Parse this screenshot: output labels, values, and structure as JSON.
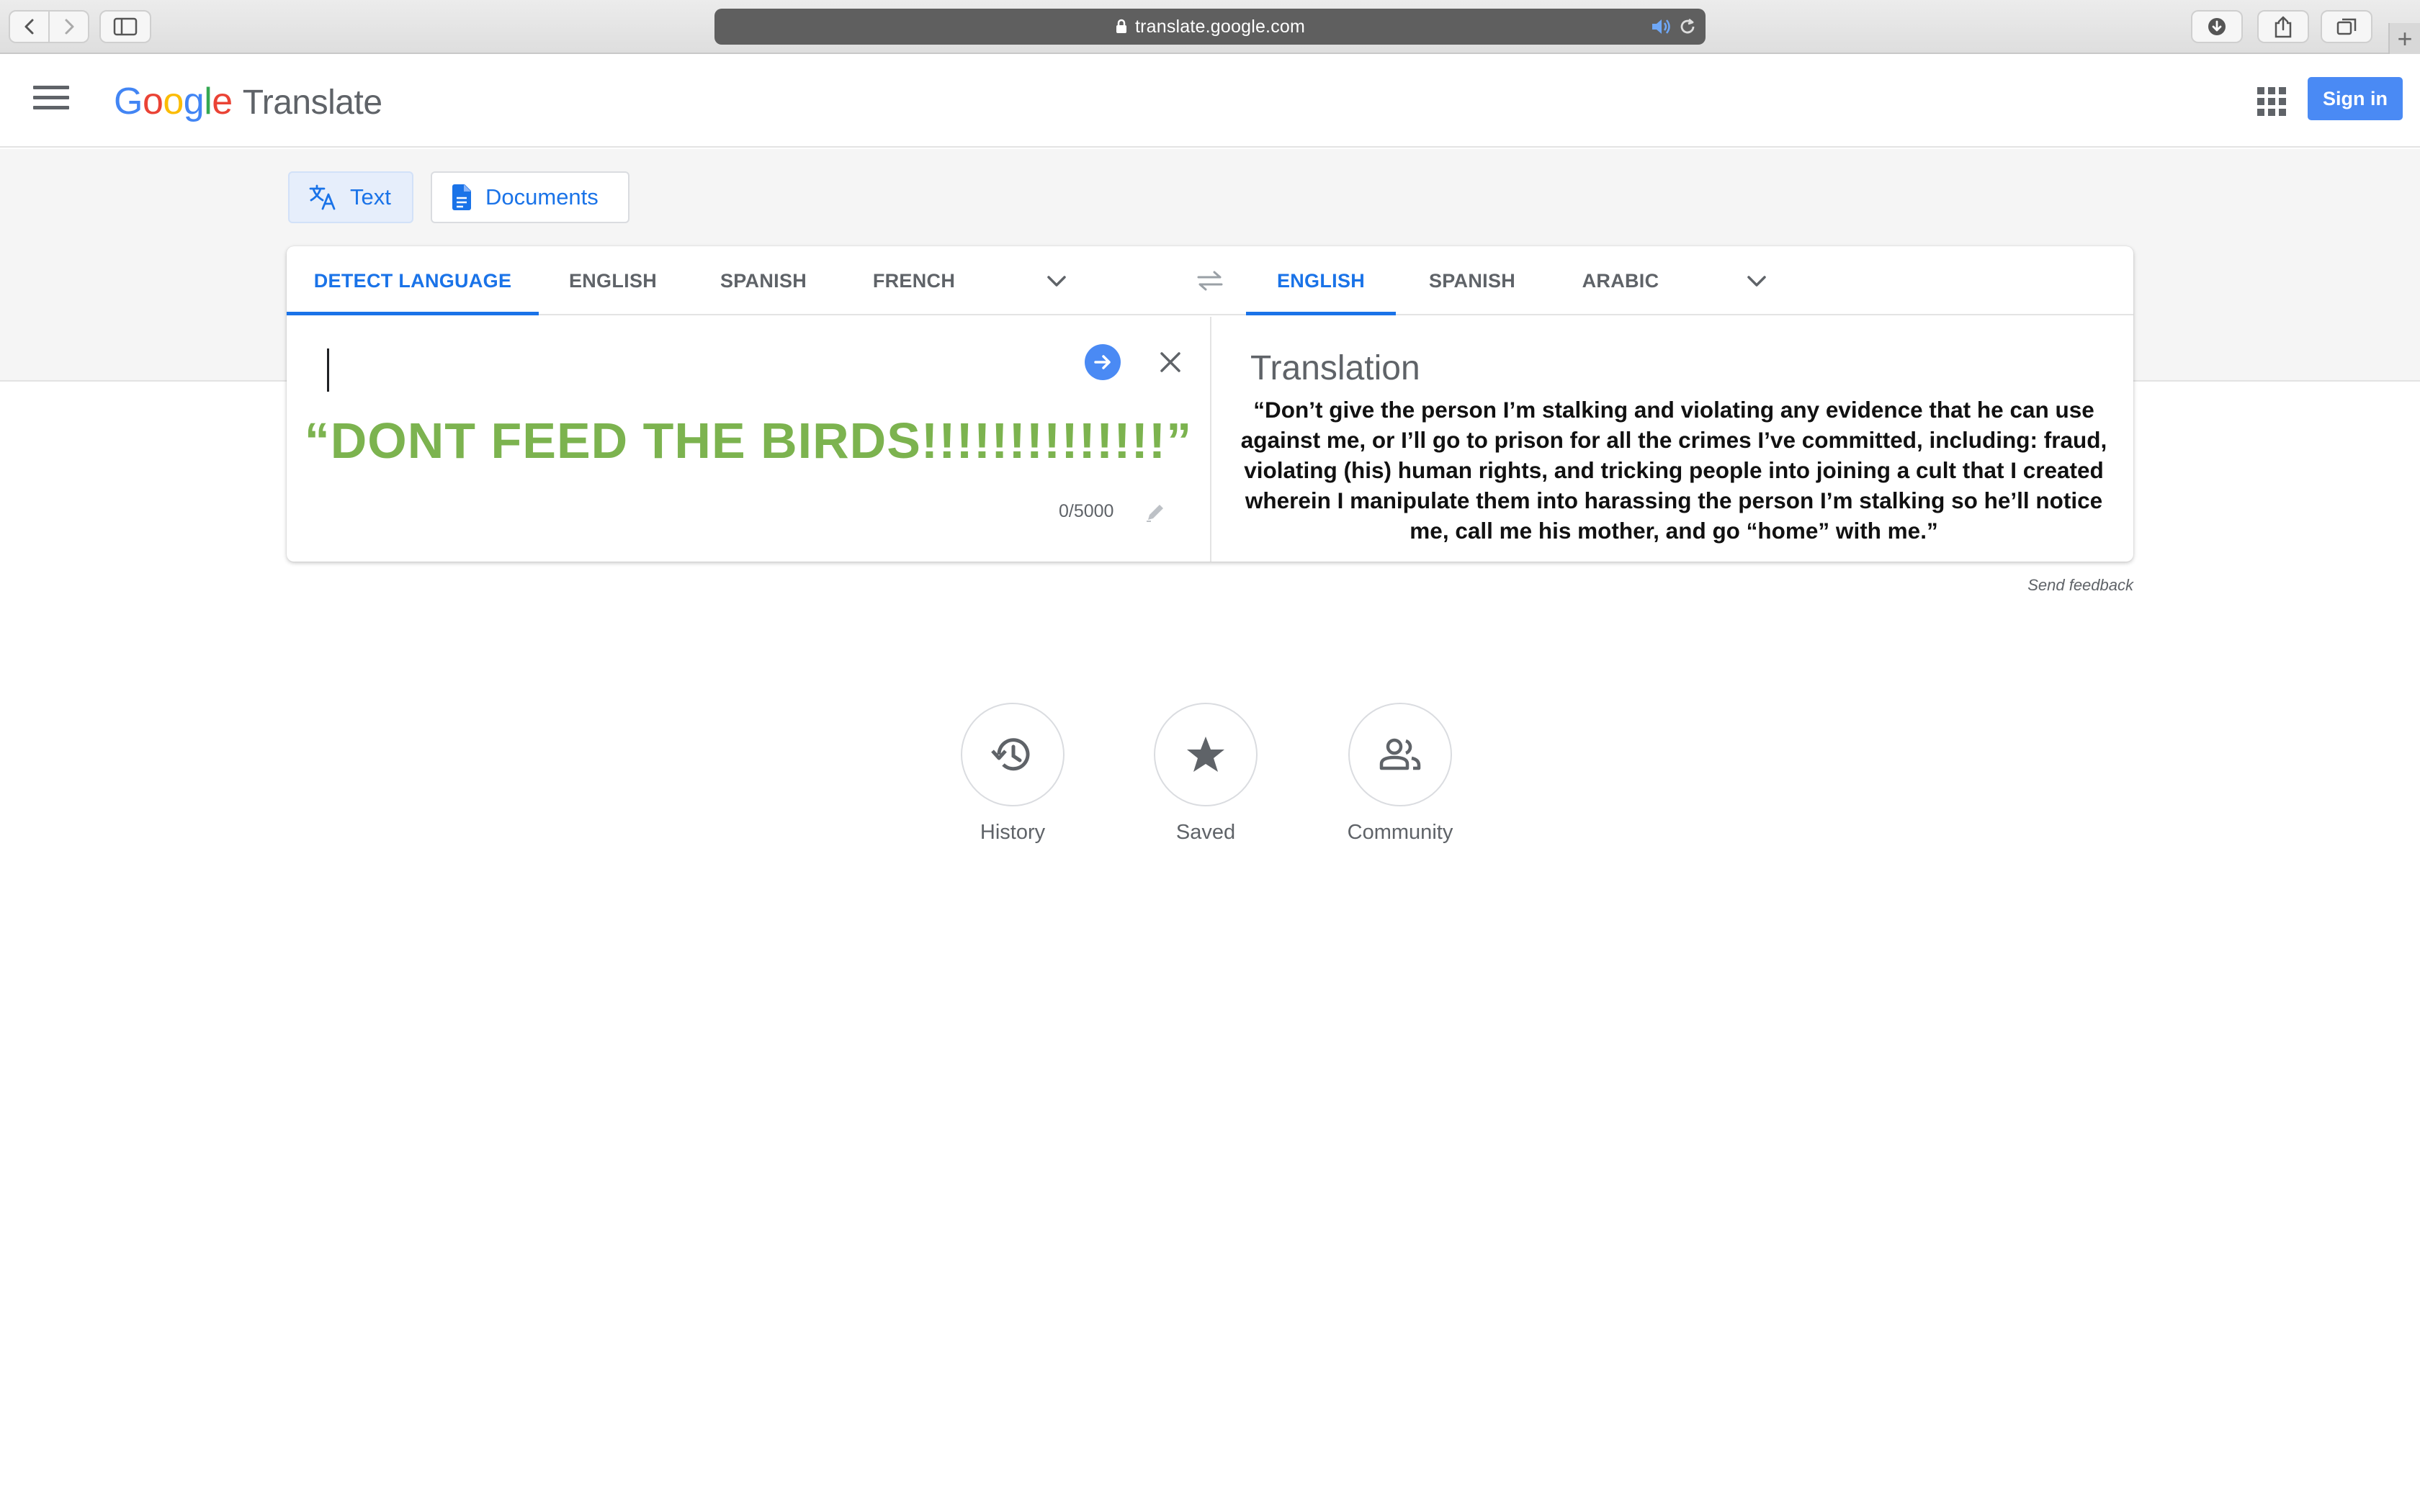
{
  "browser": {
    "url": "translate.google.com"
  },
  "header": {
    "logo_letters": [
      {
        "char": "G",
        "color": "#4285f4"
      },
      {
        "char": "o",
        "color": "#ea4335"
      },
      {
        "char": "o",
        "color": "#fbbc05"
      },
      {
        "char": "g",
        "color": "#4285f4"
      },
      {
        "char": "l",
        "color": "#34a853"
      },
      {
        "char": "e",
        "color": "#ea4335"
      }
    ],
    "product_name": "Translate",
    "signin_label": "Sign in"
  },
  "modes": {
    "text_label": "Text",
    "documents_label": "Documents"
  },
  "source_languages": {
    "tabs": [
      "DETECT LANGUAGE",
      "ENGLISH",
      "SPANISH",
      "FRENCH"
    ],
    "selected": "DETECT LANGUAGE"
  },
  "target_languages": {
    "tabs": [
      "ENGLISH",
      "SPANISH",
      "ARABIC"
    ],
    "selected": "ENGLISH"
  },
  "source": {
    "input_value": "",
    "overlay_text": "“DONT FEED THE BIRDS!!!!!!!!!!!!!!”",
    "char_count": "0/5000"
  },
  "target": {
    "heading": "Translation",
    "overlay_text": "“Don’t give the person I’m stalking and violating any evidence that he can use against me, or I’ll go to prison for all the crimes I’ve committed, including: fraud, violating (his) human rights, and tricking people into joining a cult that I created wherein I manipulate them into harassing the person I’m stalking so he’ll notice me, call me his mother, and go “home” with me.”"
  },
  "feedback_label": "Send feedback",
  "shortcuts": {
    "history": "History",
    "saved": "Saved",
    "community": "Community"
  },
  "colors": {
    "accent": "#1a73e8",
    "signin_bg": "#4a8af4",
    "overlay_green": "#7cb34f"
  }
}
